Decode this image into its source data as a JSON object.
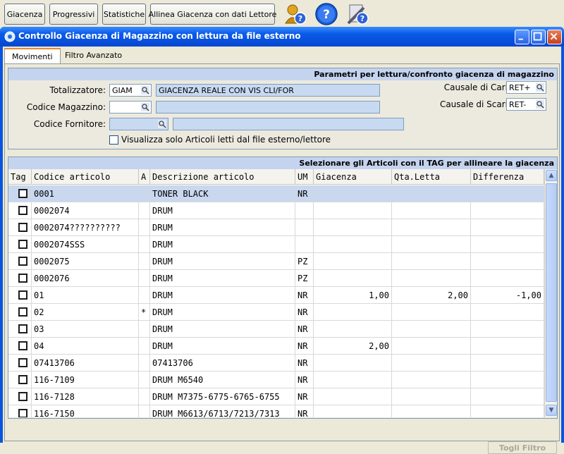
{
  "toolbar": {
    "buttons": [
      "Giacenza",
      "Progressivi",
      "Statistiche",
      "Allinea Giacenza con dati Lettore"
    ],
    "icons": [
      "user-help-icon",
      "help-icon",
      "document-help-icon"
    ]
  },
  "window": {
    "title": "Controllo Giacenza di Magazzino con lettura da file esterno"
  },
  "tabs": [
    "Movimenti",
    "Filtro Avanzato"
  ],
  "params": {
    "header": "Parametri per lettura/confronto giacenza di magazzino",
    "totalizzatore_label": "Totalizzatore:",
    "totalizzatore_code": "GIAM",
    "totalizzatore_desc": "GIACENZA REALE CON VIS CLI/FOR",
    "magazzino_label": "Codice Magazzino:",
    "magazzino_code": "",
    "magazzino_desc": "",
    "fornitore_label": "Codice Fornitore:",
    "fornitore_code": "",
    "fornitore_desc": "",
    "carico_label": "Causale di Carico:",
    "carico_value": "RET+",
    "scarico_label": "Causale di Scarico:",
    "scarico_value": "RET-",
    "visualizza_label": "Visualizza solo Articoli letti dal file esterno/lettore",
    "visualizza_checked": false
  },
  "grid": {
    "header": "Selezionare gli Articoli con il TAG per allineare la giacenza",
    "columns": [
      "Tag",
      "Codice articolo",
      "A",
      "Descrizione articolo",
      "UM",
      "Giacenza",
      "Qta.Letta",
      "Differenza"
    ],
    "rows": [
      {
        "codice": "0001",
        "a": "",
        "descrizione": "TONER BLACK",
        "um": "NR",
        "giacenza": "",
        "qta_letta": "",
        "differenza": ""
      },
      {
        "codice": "0002074",
        "a": "",
        "descrizione": "DRUM",
        "um": "",
        "giacenza": "",
        "qta_letta": "",
        "differenza": ""
      },
      {
        "codice": "0002074??????????",
        "a": "",
        "descrizione": "DRUM",
        "um": "",
        "giacenza": "",
        "qta_letta": "",
        "differenza": ""
      },
      {
        "codice": "0002074SSS",
        "a": "",
        "descrizione": "DRUM",
        "um": "",
        "giacenza": "",
        "qta_letta": "",
        "differenza": ""
      },
      {
        "codice": "0002075",
        "a": "",
        "descrizione": "DRUM",
        "um": "PZ",
        "giacenza": "",
        "qta_letta": "",
        "differenza": ""
      },
      {
        "codice": "0002076",
        "a": "",
        "descrizione": "DRUM",
        "um": "PZ",
        "giacenza": "",
        "qta_letta": "",
        "differenza": ""
      },
      {
        "codice": "01",
        "a": "",
        "descrizione": "DRUM",
        "um": "NR",
        "giacenza": "1,00",
        "qta_letta": "2,00",
        "differenza": "-1,00"
      },
      {
        "codice": "02",
        "a": "*",
        "descrizione": "DRUM",
        "um": "NR",
        "giacenza": "",
        "qta_letta": "",
        "differenza": ""
      },
      {
        "codice": "03",
        "a": "",
        "descrizione": "DRUM",
        "um": "NR",
        "giacenza": "",
        "qta_letta": "",
        "differenza": ""
      },
      {
        "codice": "04",
        "a": "",
        "descrizione": "DRUM",
        "um": "NR",
        "giacenza": "2,00",
        "qta_letta": "",
        "differenza": ""
      },
      {
        "codice": "07413706",
        "a": "",
        "descrizione": "07413706",
        "um": "NR",
        "giacenza": "",
        "qta_letta": "",
        "differenza": ""
      },
      {
        "codice": "116-7109",
        "a": "",
        "descrizione": "DRUM M6540",
        "um": "NR",
        "giacenza": "",
        "qta_letta": "",
        "differenza": ""
      },
      {
        "codice": "116-7128",
        "a": "",
        "descrizione": "DRUM M7375-6775-6765-6755",
        "um": "NR",
        "giacenza": "",
        "qta_letta": "",
        "differenza": ""
      },
      {
        "codice": "116-7150",
        "a": "",
        "descrizione": "DRUM M6613/6713/7213/7313",
        "um": "NR",
        "giacenza": "",
        "qta_letta": "",
        "differenza": ""
      }
    ],
    "selected_row": 0
  },
  "footer": {
    "togli_filtro_label": "Togli Filtro"
  }
}
